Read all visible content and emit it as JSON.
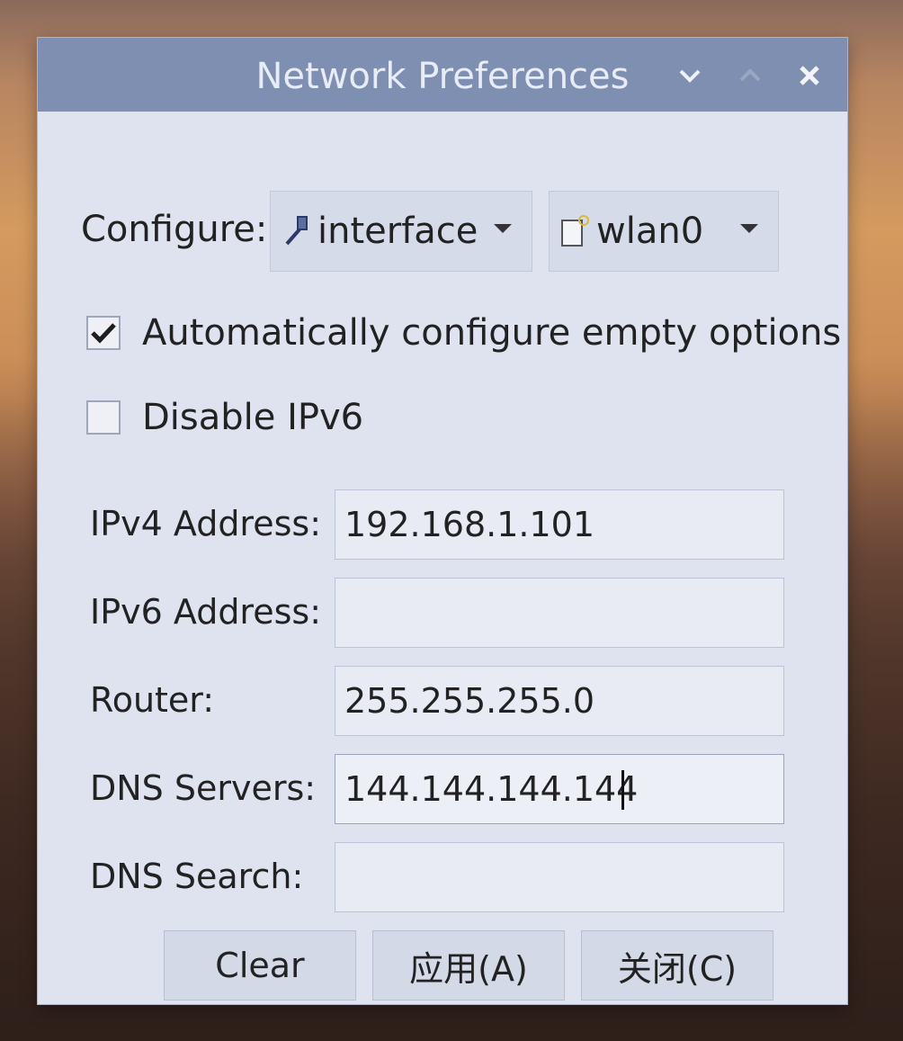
{
  "window": {
    "title": "Network Preferences"
  },
  "configure": {
    "label": "Configure:",
    "type_value": "interface",
    "device_value": "wlan0"
  },
  "options": {
    "auto_configure_label": "Automatically configure empty options",
    "auto_configure_checked": true,
    "disable_ipv6_label": "Disable IPv6",
    "disable_ipv6_checked": false
  },
  "fields": {
    "ipv4_label": "IPv4 Address:",
    "ipv4_value": "192.168.1.101",
    "ipv6_label": "IPv6 Address:",
    "ipv6_value": "",
    "router_label": "Router:",
    "router_value": "255.255.255.0",
    "dns_servers_label": "DNS Servers:",
    "dns_servers_value": "144.144.144.144",
    "dns_search_label": "DNS Search:",
    "dns_search_value": ""
  },
  "buttons": {
    "clear": "Clear",
    "apply": "应用(A)",
    "close": "关闭(C)"
  },
  "icons": {
    "interface": "wrench-icon",
    "device": "wireless-adapter-icon",
    "minimize": "chevron-down-icon",
    "maximize": "chevron-up-icon",
    "close": "close-icon"
  },
  "colors": {
    "titlebar": "#7f8fb2",
    "window_bg": "#dfe3f0",
    "input_bg": "#e8ebf4"
  }
}
